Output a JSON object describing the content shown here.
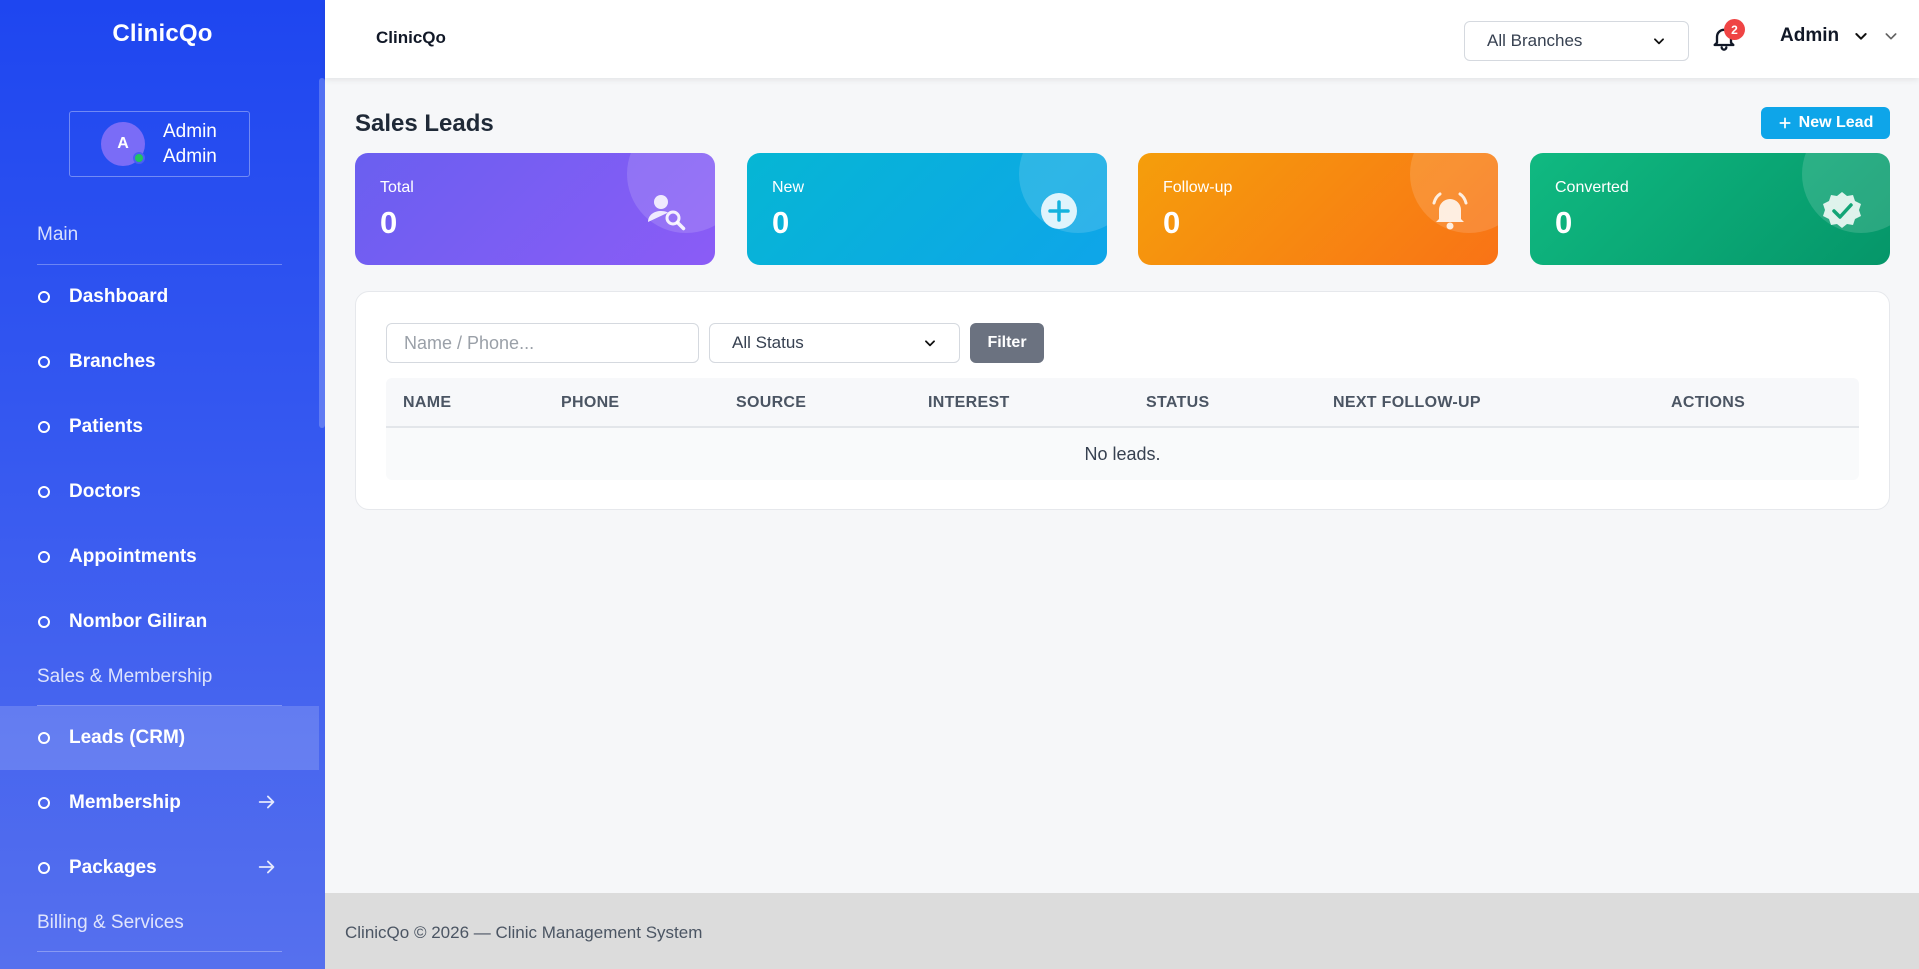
{
  "sidebar": {
    "brand": "ClinicQo",
    "user": {
      "initial": "A",
      "name": "Admin",
      "role": "Admin"
    },
    "sections": [
      {
        "label": "Main"
      },
      {
        "label": "Sales & Membership"
      },
      {
        "label": "Billing & Services"
      }
    ],
    "items": [
      {
        "label": "Dashboard"
      },
      {
        "label": "Branches"
      },
      {
        "label": "Patients"
      },
      {
        "label": "Doctors"
      },
      {
        "label": "Appointments"
      },
      {
        "label": "Nombor Giliran"
      },
      {
        "label": "Leads (CRM)",
        "active": true
      },
      {
        "label": "Membership",
        "has_arrow": true
      },
      {
        "label": "Packages",
        "has_arrow": true
      }
    ]
  },
  "topbar": {
    "title": "ClinicQo",
    "branch_select": "All Branches",
    "notification_count": "2",
    "admin_label": "Admin"
  },
  "main": {
    "title": "Sales Leads",
    "new_lead_label": "New Lead",
    "stats": [
      {
        "label": "Total",
        "value": "0",
        "icon": "user-search-icon",
        "color": "#7360f2"
      },
      {
        "label": "New",
        "value": "0",
        "icon": "plus-circle-icon",
        "color": "#0bb1dc"
      },
      {
        "label": "Follow-up",
        "value": "0",
        "icon": "bell-ring-icon",
        "color": "#f7890f"
      },
      {
        "label": "Converted",
        "value": "0",
        "icon": "badge-check-icon",
        "color": "#0fb07c"
      }
    ],
    "filters": {
      "search_placeholder": "Name / Phone...",
      "status_select": "All Status",
      "filter_label": "Filter"
    },
    "table": {
      "columns": [
        "NAME",
        "PHONE",
        "SOURCE",
        "INTEREST",
        "STATUS",
        "NEXT FOLLOW-UP",
        "ACTIONS"
      ],
      "empty_text": "No leads."
    }
  },
  "footer": {
    "text": "ClinicQo © 2026 — Clinic Management System"
  },
  "colors": {
    "sidebar_top": "#1e46f0",
    "accent": "#0ea5e9",
    "filter_btn": "#6b7280",
    "badge": "#ef4444"
  }
}
